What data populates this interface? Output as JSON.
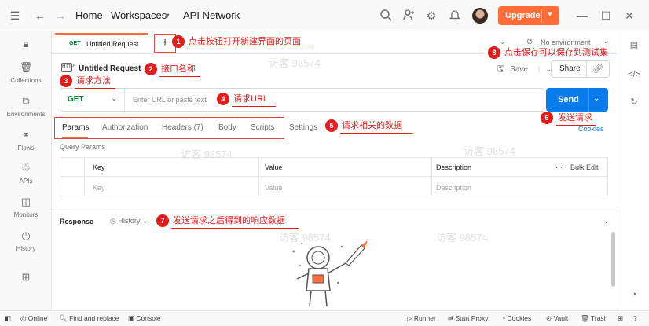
{
  "topbar": {
    "home": "Home",
    "workspaces": "Workspaces",
    "api_network": "API Network",
    "upgrade": "Upgrade"
  },
  "sidebar": {
    "items": [
      {
        "label": "Collections",
        "icon": "collections-icon"
      },
      {
        "label": "Environments",
        "icon": "environments-icon"
      },
      {
        "label": "Flows",
        "icon": "flows-icon"
      },
      {
        "label": "APIs",
        "icon": "apis-icon"
      },
      {
        "label": "Monitors",
        "icon": "monitors-icon"
      },
      {
        "label": "History",
        "icon": "history-icon"
      }
    ]
  },
  "tabs": {
    "active_method": "GET",
    "active_title": "Untitled Request",
    "environment": "No environment"
  },
  "request": {
    "name": "Untitled Request",
    "save": "Save",
    "share": "Share",
    "method": "GET",
    "url_placeholder": "Enter URL or paste text",
    "send": "Send",
    "cookies": "Cookies",
    "subtabs": [
      "Params",
      "Authorization",
      "Headers (7)",
      "Body",
      "Scripts",
      "Settings"
    ]
  },
  "query_params": {
    "title": "Query Params",
    "headers": [
      "Key",
      "Value",
      "Description"
    ],
    "bulk_edit": "Bulk Edit",
    "placeholders": [
      "Key",
      "Value",
      "Description"
    ]
  },
  "response": {
    "title": "Response",
    "history": "History"
  },
  "statusbar": {
    "online": "Online",
    "find_replace": "Find and replace",
    "console": "Console",
    "runner": "Runner",
    "start_proxy": "Start Proxy",
    "cookies": "Cookies",
    "vault": "Vault",
    "trash": "Trash"
  },
  "annotations": [
    {
      "num": "1",
      "text": "点击按钮打开新建界面的页面"
    },
    {
      "num": "2",
      "text": "接口名称"
    },
    {
      "num": "3",
      "text": "请求方法"
    },
    {
      "num": "4",
      "text": "请求URL"
    },
    {
      "num": "5",
      "text": "请求相关的数据"
    },
    {
      "num": "6",
      "text": "发送请求"
    },
    {
      "num": "7",
      "text": "发送请求之后得到的响应数据"
    },
    {
      "num": "8",
      "text": "点击保存可以保存到测试集"
    }
  ],
  "watermark": "访客 98574",
  "colors": {
    "accent": "#ff6c37",
    "send_blue": "#097bed",
    "method_green": "#007f31",
    "annotation_red": "#e21b1b"
  }
}
